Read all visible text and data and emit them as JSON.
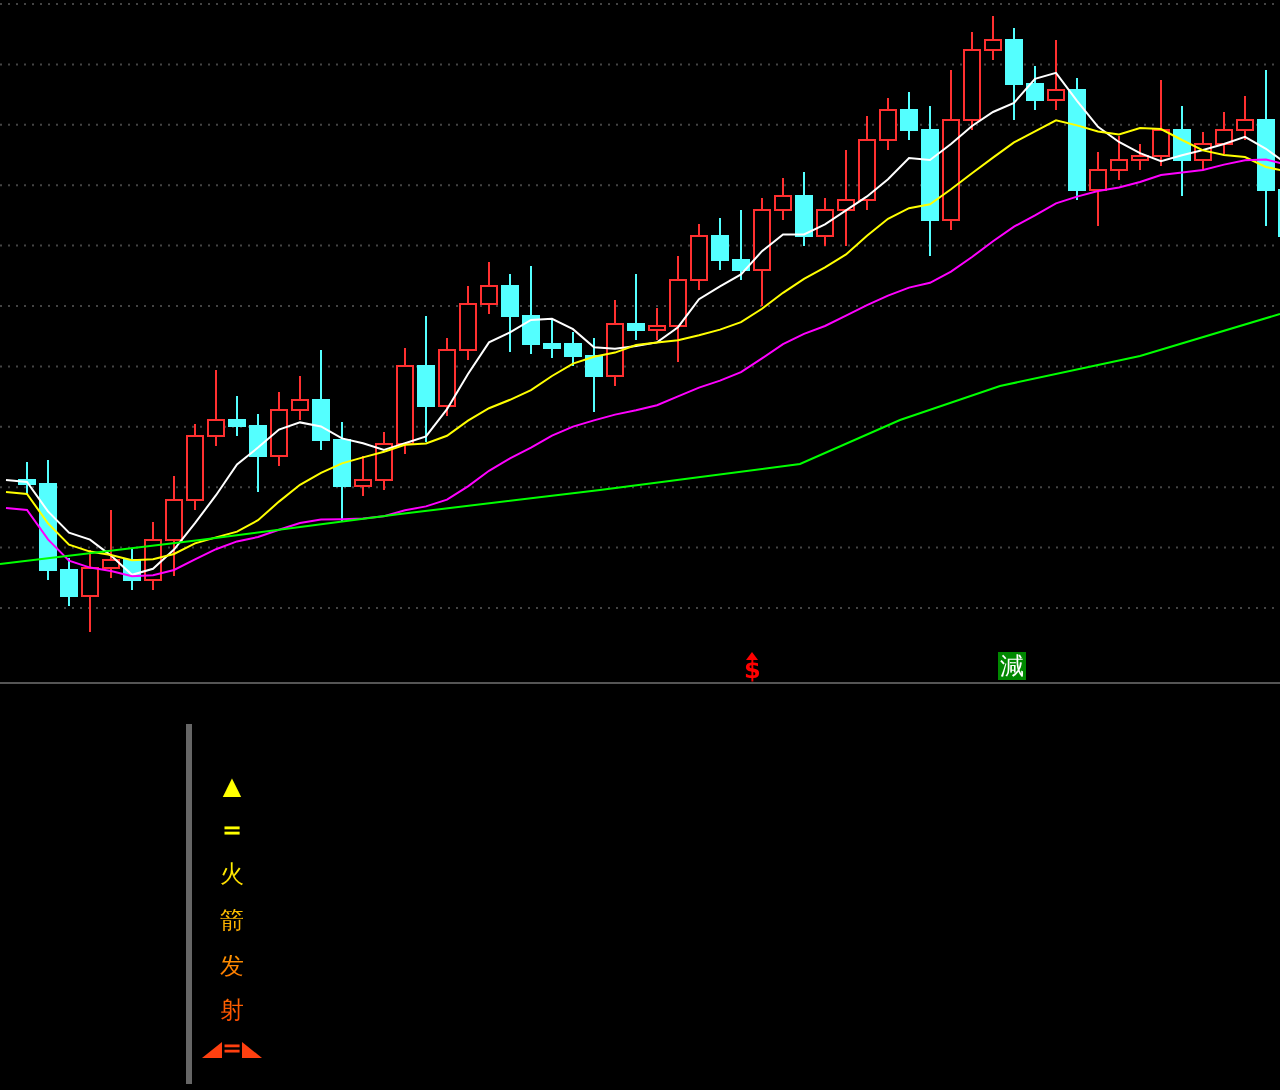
{
  "main_chart": {
    "signals": [
      {
        "kind": "dollar",
        "text": "$"
      },
      {
        "kind": "reduce",
        "text": "減"
      }
    ]
  },
  "indicator_panel": {
    "arrow": "▲",
    "mark": "=",
    "label": "火箭发射",
    "footer_mark": "="
  }
}
